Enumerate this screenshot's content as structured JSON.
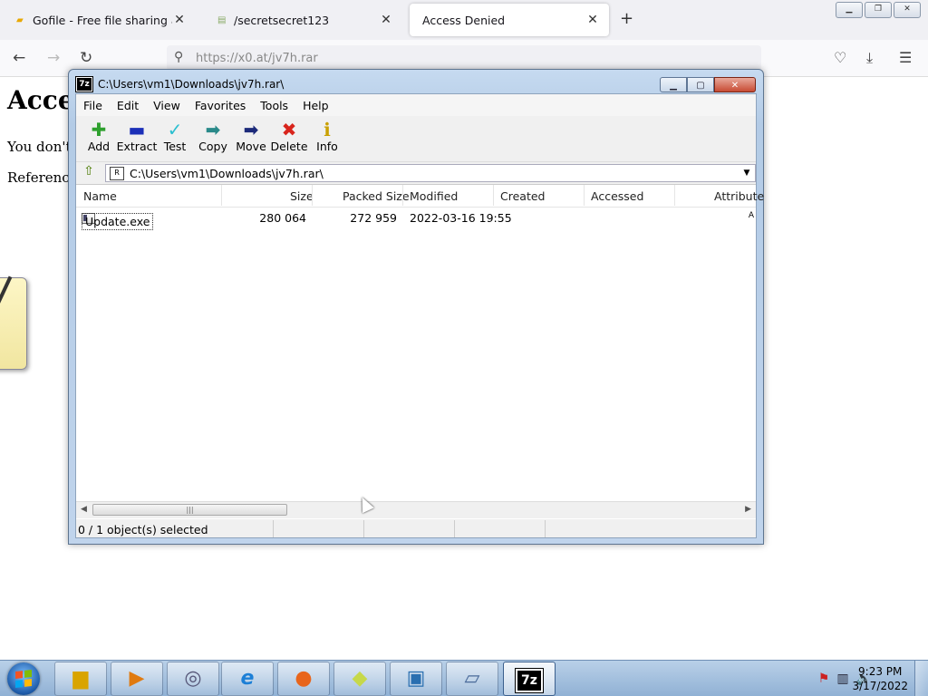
{
  "browser": {
    "tabs": [
      {
        "title": "Gofile - Free file sharing and sto",
        "favicon": "folder-icon"
      },
      {
        "title": "/secretsecret123",
        "favicon": "page-icon"
      },
      {
        "title": "Access Denied",
        "favicon": ""
      }
    ],
    "url": "https://x0.at/jv7h.rar",
    "page": {
      "heading": "Acce",
      "line1": "You don't h",
      "line2": "Reference"
    }
  },
  "sevenzip": {
    "title": "C:\\Users\\vm1\\Downloads\\jv7h.rar\\",
    "menu": [
      "File",
      "Edit",
      "View",
      "Favorites",
      "Tools",
      "Help"
    ],
    "toolbar": [
      {
        "label": "Add",
        "icon": "add-icon",
        "color": "#2ea02e"
      },
      {
        "label": "Extract",
        "icon": "extract-icon",
        "color": "#1b2fb8"
      },
      {
        "label": "Test",
        "icon": "test-icon",
        "color": "#2bbfd0"
      },
      {
        "label": "Copy",
        "icon": "copy-icon",
        "color": "#2a8a8a"
      },
      {
        "label": "Move",
        "icon": "move-icon",
        "color": "#1c2a7a"
      },
      {
        "label": "Delete",
        "icon": "delete-icon",
        "color": "#d8241c"
      },
      {
        "label": "Info",
        "icon": "info-icon",
        "color": "#c9a000"
      }
    ],
    "address": "C:\\Users\\vm1\\Downloads\\jv7h.rar\\",
    "columns": [
      "Name",
      "Size",
      "Packed Size",
      "Modified",
      "Created",
      "Accessed",
      "Attribute"
    ],
    "rows": [
      {
        "name": "Update.exe",
        "size": "280 064",
        "packed": "272 959",
        "modified": "2022-03-16 19:55",
        "created": "",
        "accessed": "",
        "attr": "A"
      }
    ],
    "status": "0 / 1 object(s) selected"
  },
  "taskbar": {
    "time": "9:23 PM",
    "date": "3/17/2022",
    "apps": [
      "explorer",
      "media-player",
      "media-center",
      "internet-explorer",
      "firefox",
      "sticky-notes",
      "remote-desktop",
      "disk-drive",
      "7-zip"
    ],
    "active_app_label": "7z"
  }
}
